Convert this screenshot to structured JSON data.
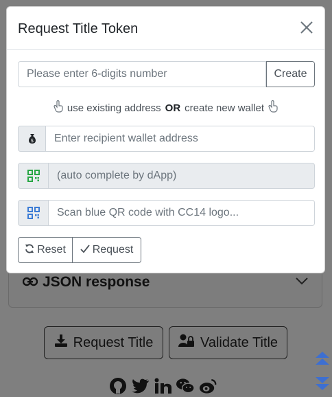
{
  "modal": {
    "title": "Request Title Token",
    "number_placeholder": "Please enter 6-digits number",
    "create_label": "Create",
    "hint_prefix": "use existing address",
    "hint_or": "OR",
    "hint_suffix": "create new wallet",
    "recipient_placeholder": "Enter recipient wallet address",
    "autocomplete_placeholder": "(auto complete by dApp)",
    "scan_placeholder": "Scan blue QR code with CC14 logo...",
    "reset_label": "Reset",
    "request_label": "Request"
  },
  "background": {
    "accordion_title": "JSON response",
    "request_title_label": "Request Title",
    "validate_title_label": "Validate Title",
    "social_icons": [
      "github-icon",
      "twitter-icon",
      "linkedin-icon",
      "wechat-icon",
      "weibo-icon"
    ]
  },
  "colors": {
    "overlay": "#7f7f7f",
    "qr_green": "#28a745",
    "qr_blue": "#3a7bd5",
    "scroll_arrow": "#3d6fd1"
  }
}
